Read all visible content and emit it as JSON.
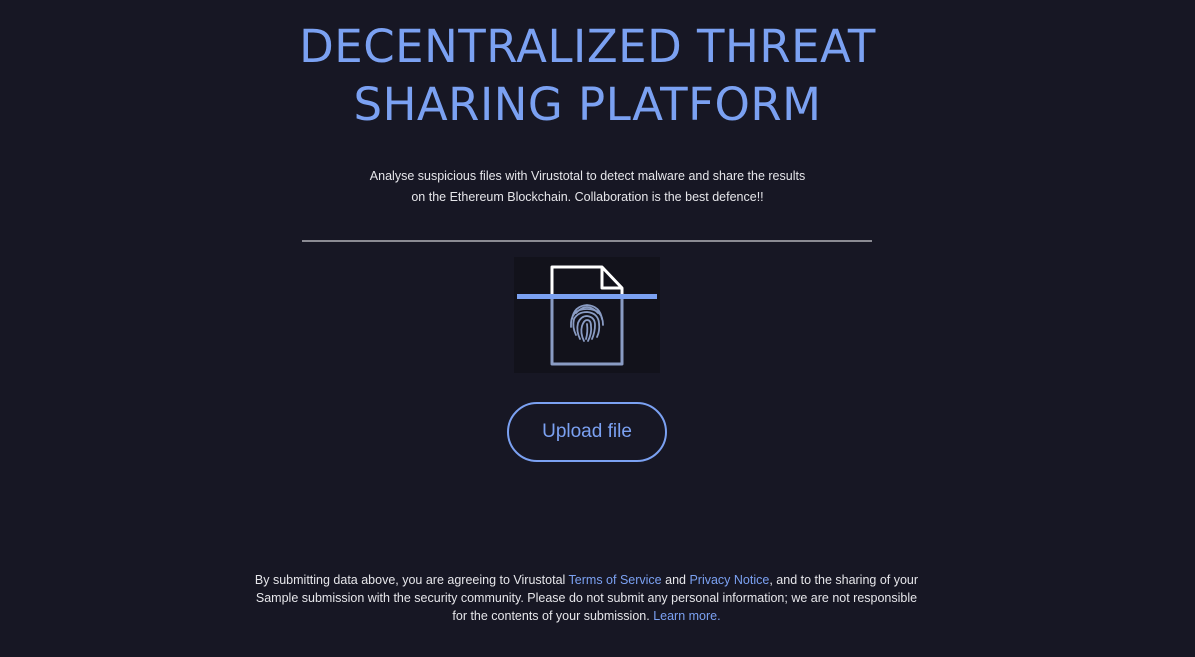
{
  "header": {
    "title_line1": "DECENTRALIZED THREAT",
    "title_line2": "SHARING PLATFORM"
  },
  "intro": {
    "line1": "Analyse suspicious files with Virustotal to detect malware and share the results",
    "line2": "on the Ethereum Blockchain. Collaboration is the best defence!!"
  },
  "scan_graphic": {
    "icon": "fingerprint-scan-document-icon",
    "accent_color": "#7ba1f2"
  },
  "upload": {
    "button_label": "Upload file"
  },
  "footer": {
    "text1": "By submitting data above, you are agreeing to Virustotal ",
    "terms_link": "Terms of Service",
    "text2": " and ",
    "privacy_link": "Privacy Notice",
    "text3": ", and to the sharing of your",
    "line2": "Sample submission with the security community. Please do not submit any personal information; we are not responsible",
    "text4": "for the contents of your submission. ",
    "learn_more_link": "Learn more."
  },
  "colors": {
    "background": "#171724",
    "accent": "#7ba1f2",
    "text": "#e6e6ea"
  }
}
